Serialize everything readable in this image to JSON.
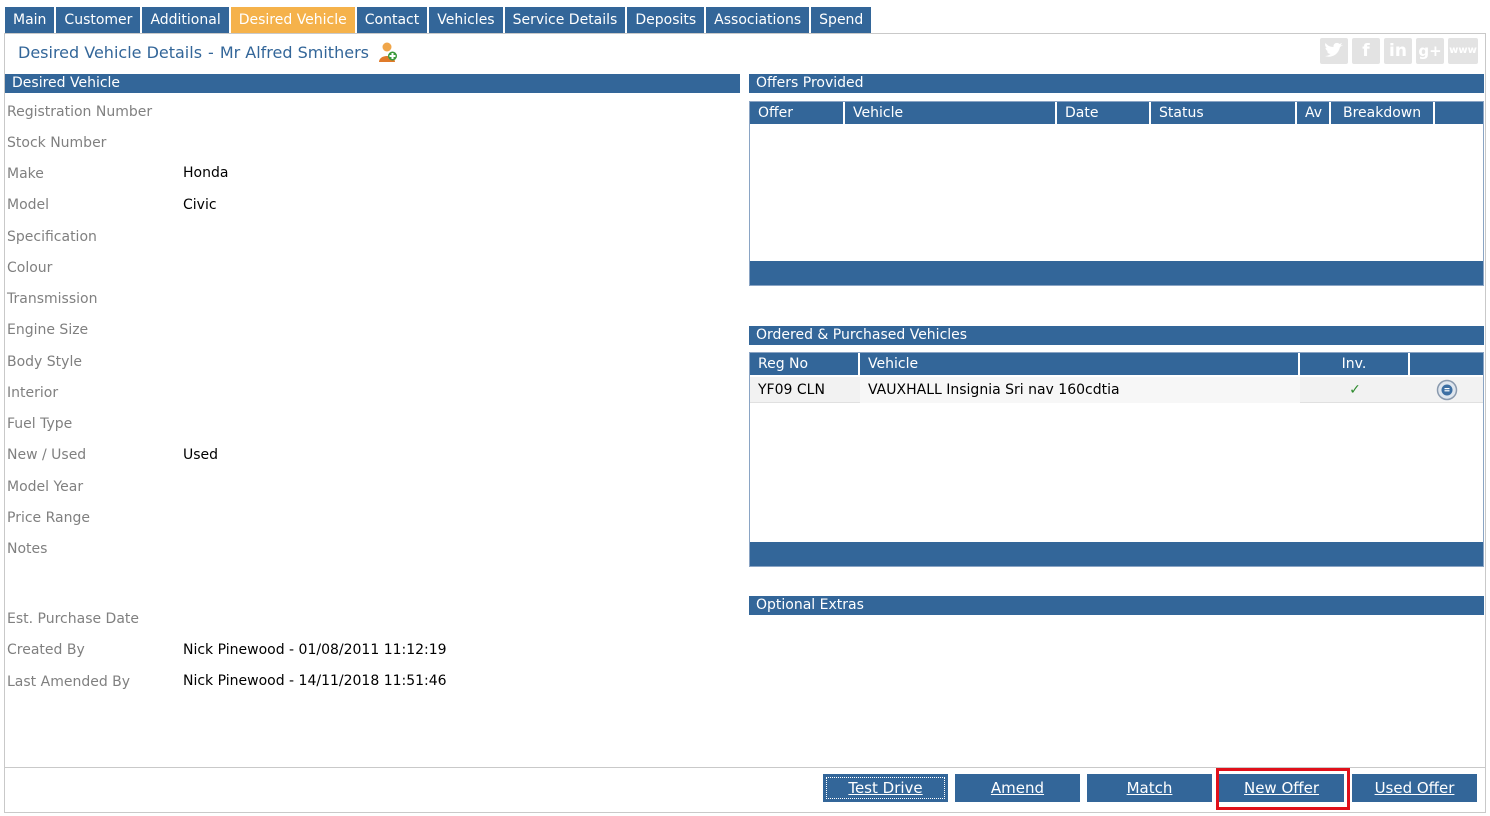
{
  "tabs": [
    {
      "label": "Main"
    },
    {
      "label": "Customer"
    },
    {
      "label": "Additional"
    },
    {
      "label": "Desired Vehicle",
      "active": true
    },
    {
      "label": "Contact"
    },
    {
      "label": "Vehicles"
    },
    {
      "label": "Service Details"
    },
    {
      "label": "Deposits"
    },
    {
      "label": "Associations"
    },
    {
      "label": "Spend"
    }
  ],
  "header": {
    "title": "Desired Vehicle Details",
    "separator": "-",
    "customer": "Mr Alfred Smithers",
    "person_icon": "person-add-icon"
  },
  "social": {
    "twitter": "twitter-icon",
    "facebook": "f",
    "linkedin": "in",
    "googleplus": "g+",
    "www": "www"
  },
  "desired_vehicle": {
    "heading": "Desired Vehicle",
    "fields": [
      {
        "label": "Registration Number",
        "value": ""
      },
      {
        "label": "Stock Number",
        "value": ""
      },
      {
        "label": "Make",
        "value": "Honda"
      },
      {
        "label": "Model",
        "value": "Civic"
      },
      {
        "label": "Specification",
        "value": ""
      },
      {
        "label": "Colour",
        "value": ""
      },
      {
        "label": "Transmission",
        "value": ""
      },
      {
        "label": "Engine Size",
        "value": ""
      },
      {
        "label": "Body Style",
        "value": ""
      },
      {
        "label": "Interior",
        "value": ""
      },
      {
        "label": "Fuel Type",
        "value": ""
      },
      {
        "label": "New / Used",
        "value": "Used"
      },
      {
        "label": "Model Year",
        "value": ""
      },
      {
        "label": "Price Range",
        "value": ""
      },
      {
        "label": "Notes",
        "value": ""
      },
      {
        "label": "Est. Purchase Date",
        "value": ""
      },
      {
        "label": "Created By",
        "value": "Nick Pinewood - 01/08/2011 11:12:19"
      },
      {
        "label": "Last Amended By",
        "value": "Nick Pinewood - 14/11/2018 11:51:46"
      }
    ]
  },
  "offers": {
    "heading": "Offers Provided",
    "columns": [
      "Offer",
      "Vehicle",
      "Date",
      "Status",
      "Av",
      "Breakdown",
      ""
    ]
  },
  "ordered": {
    "heading": "Ordered & Purchased Vehicles",
    "columns": [
      "Reg No",
      "Vehicle",
      "Inv.",
      ""
    ],
    "rows": [
      {
        "reg": "YF09 CLN",
        "vehicle": "VAUXHALL Insignia Sri nav 160cdtia",
        "inv": "✓",
        "action_icon": "details-icon"
      }
    ]
  },
  "extras": {
    "heading": "Optional Extras"
  },
  "buttons": {
    "test_drive": "Test Drive",
    "amend": "Amend",
    "match": "Match",
    "new_offer": "New Offer",
    "used_offer": "Used Offer"
  },
  "colors": {
    "primary": "#336699",
    "active_tab": "#f5b24b",
    "label_grey": "#808080",
    "highlight": "#e0101a",
    "check": "#2e8b2e"
  }
}
